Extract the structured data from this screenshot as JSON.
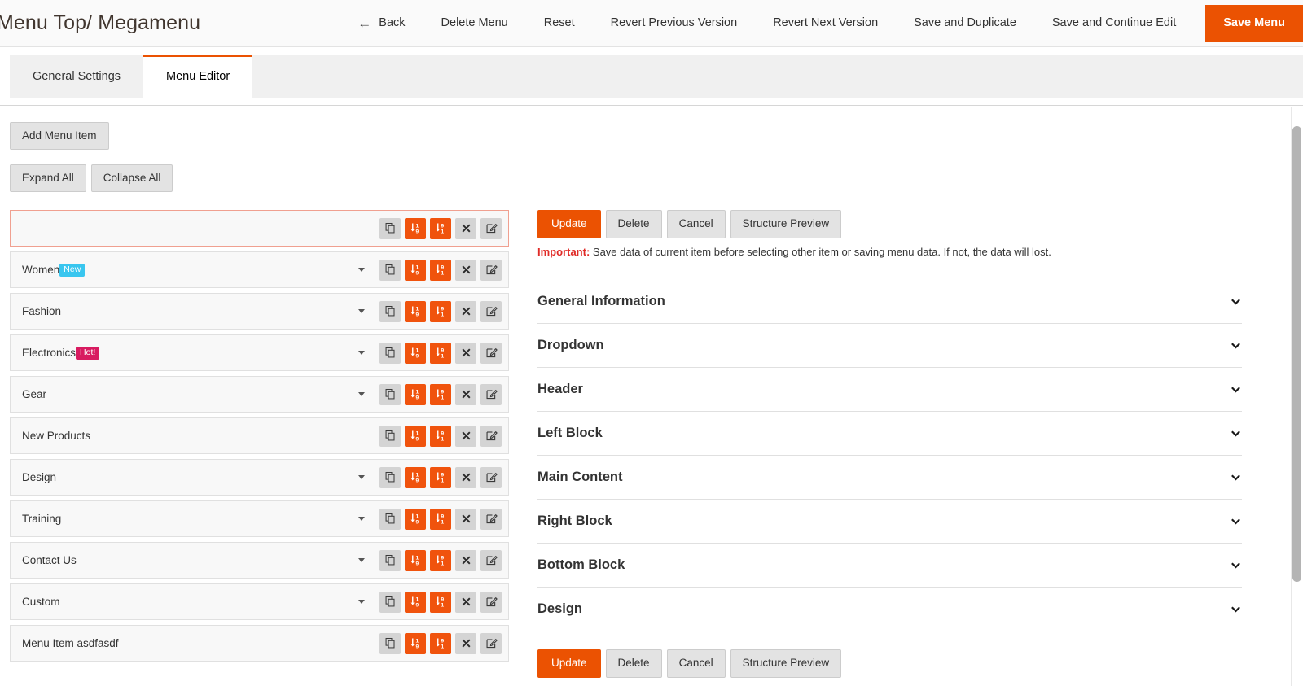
{
  "header": {
    "title": "Menu Top/ Megamenu",
    "back_arrow": "←",
    "actions": [
      {
        "label": "Back",
        "name": "back-button",
        "style": "link",
        "has_arrow": true
      },
      {
        "label": "Delete Menu",
        "name": "delete-menu-button",
        "style": "link",
        "has_arrow": false
      },
      {
        "label": "Reset",
        "name": "reset-button",
        "style": "link",
        "has_arrow": false
      },
      {
        "label": "Revert Previous Version",
        "name": "revert-previous-version-button",
        "style": "link",
        "has_arrow": false
      },
      {
        "label": "Revert Next Version",
        "name": "revert-next-version-button",
        "style": "link",
        "has_arrow": false
      },
      {
        "label": "Save and Duplicate",
        "name": "save-and-duplicate-button",
        "style": "link",
        "has_arrow": false
      },
      {
        "label": "Save and Continue Edit",
        "name": "save-and-continue-edit-button",
        "style": "link",
        "has_arrow": false
      },
      {
        "label": "Save Menu",
        "name": "save-menu-button",
        "style": "primary",
        "has_arrow": false
      }
    ]
  },
  "tabs": [
    {
      "label": "General Settings",
      "name": "tab-general-settings",
      "active": false
    },
    {
      "label": "Menu Editor",
      "name": "tab-menu-editor",
      "active": true
    }
  ],
  "toolbar": {
    "add_menu_item": "Add Menu Item",
    "expand_all": "Expand All",
    "collapse_all": "Collapse All"
  },
  "menu_items": [
    {
      "label": "",
      "badge": null,
      "badge_type": null,
      "has_caret": false,
      "selected": true
    },
    {
      "label": "Women",
      "badge": "New",
      "badge_type": "new",
      "has_caret": true,
      "selected": false
    },
    {
      "label": "Fashion",
      "badge": null,
      "badge_type": null,
      "has_caret": true,
      "selected": false
    },
    {
      "label": "Electronics",
      "badge": "Hot!",
      "badge_type": "hot",
      "has_caret": true,
      "selected": false
    },
    {
      "label": "Gear",
      "badge": null,
      "badge_type": null,
      "has_caret": true,
      "selected": false
    },
    {
      "label": "New Products",
      "badge": null,
      "badge_type": null,
      "has_caret": false,
      "selected": false
    },
    {
      "label": "Design",
      "badge": null,
      "badge_type": null,
      "has_caret": true,
      "selected": false
    },
    {
      "label": "Training",
      "badge": null,
      "badge_type": null,
      "has_caret": true,
      "selected": false
    },
    {
      "label": "Contact Us",
      "badge": null,
      "badge_type": null,
      "has_caret": true,
      "selected": false
    },
    {
      "label": "Custom",
      "badge": null,
      "badge_type": null,
      "has_caret": true,
      "selected": false
    },
    {
      "label": "Menu Item asdfasdf",
      "badge": null,
      "badge_type": null,
      "has_caret": false,
      "selected": false
    }
  ],
  "row_action_icons": [
    {
      "name": "duplicate-icon",
      "style": "grey"
    },
    {
      "name": "sort-ascending-icon",
      "style": "orange"
    },
    {
      "name": "sort-descending-icon",
      "style": "orange"
    },
    {
      "name": "close-icon",
      "style": "grey"
    },
    {
      "name": "edit-icon",
      "style": "grey"
    }
  ],
  "panel": {
    "buttons": [
      {
        "label": "Update",
        "name": "update-button",
        "style": "orange"
      },
      {
        "label": "Delete",
        "name": "delete-button",
        "style": "grey"
      },
      {
        "label": "Cancel",
        "name": "cancel-button",
        "style": "grey"
      },
      {
        "label": "Structure Preview",
        "name": "structure-preview-button",
        "style": "grey"
      }
    ],
    "important_label": "Important:",
    "important_text": " Save data of current item before selecting other item or saving menu data. If not, the data will lost.",
    "sections": [
      {
        "label": "General Information",
        "name": "section-general-information"
      },
      {
        "label": "Dropdown",
        "name": "section-dropdown"
      },
      {
        "label": "Header",
        "name": "section-header"
      },
      {
        "label": "Left Block",
        "name": "section-left-block"
      },
      {
        "label": "Main Content",
        "name": "section-main-content"
      },
      {
        "label": "Right Block",
        "name": "section-right-block"
      },
      {
        "label": "Bottom Block",
        "name": "section-bottom-block"
      },
      {
        "label": "Design",
        "name": "section-design"
      }
    ]
  },
  "colors": {
    "accent": "#eb5202",
    "icon_orange": "#f0530d",
    "badge_new": "#39c6ef",
    "badge_hot": "#d81b60",
    "important": "#e02b27"
  }
}
